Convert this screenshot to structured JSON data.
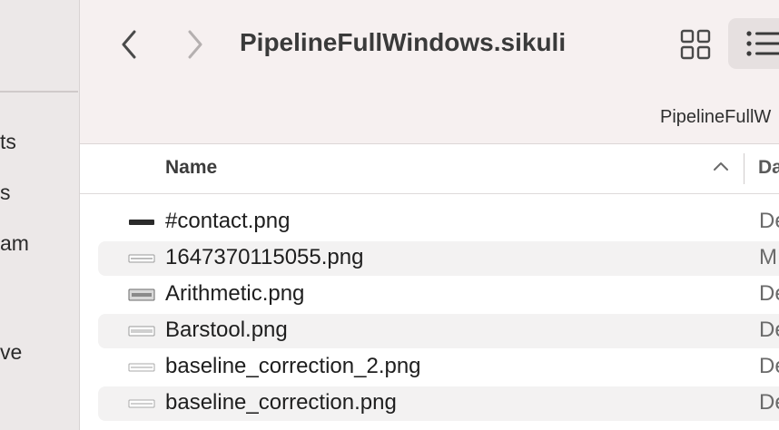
{
  "sidebar": {
    "items": [
      {
        "label": "ts"
      },
      {
        "label": "s"
      },
      {
        "label": "am"
      },
      {
        "label": "ve"
      }
    ]
  },
  "toolbar": {
    "back_icon": "chevron-left-icon",
    "forward_icon": "chevron-right-icon",
    "title": "PipelineFullWindows.sikuli",
    "grid_view_icon": "grid-view-icon",
    "list_view_icon": "list-view-icon",
    "path_label": "PipelineFullW"
  },
  "columns": {
    "name": "Name",
    "date": "Da",
    "sort_icon": "chevron-up-icon"
  },
  "files": [
    {
      "name": "#contact.png",
      "date": "De"
    },
    {
      "name": "1647370115055.png",
      "date": "M"
    },
    {
      "name": "Arithmetic.png",
      "date": "De"
    },
    {
      "name": "Barstool.png",
      "date": "De"
    },
    {
      "name": "baseline_correction_2.png",
      "date": "De"
    },
    {
      "name": "baseline_correction.png",
      "date": "De"
    }
  ],
  "colors": {
    "toolbar_bg": "#f6f0f0",
    "sidebar_bg": "#ece8e8",
    "alt_row": "#f3f2f2"
  }
}
